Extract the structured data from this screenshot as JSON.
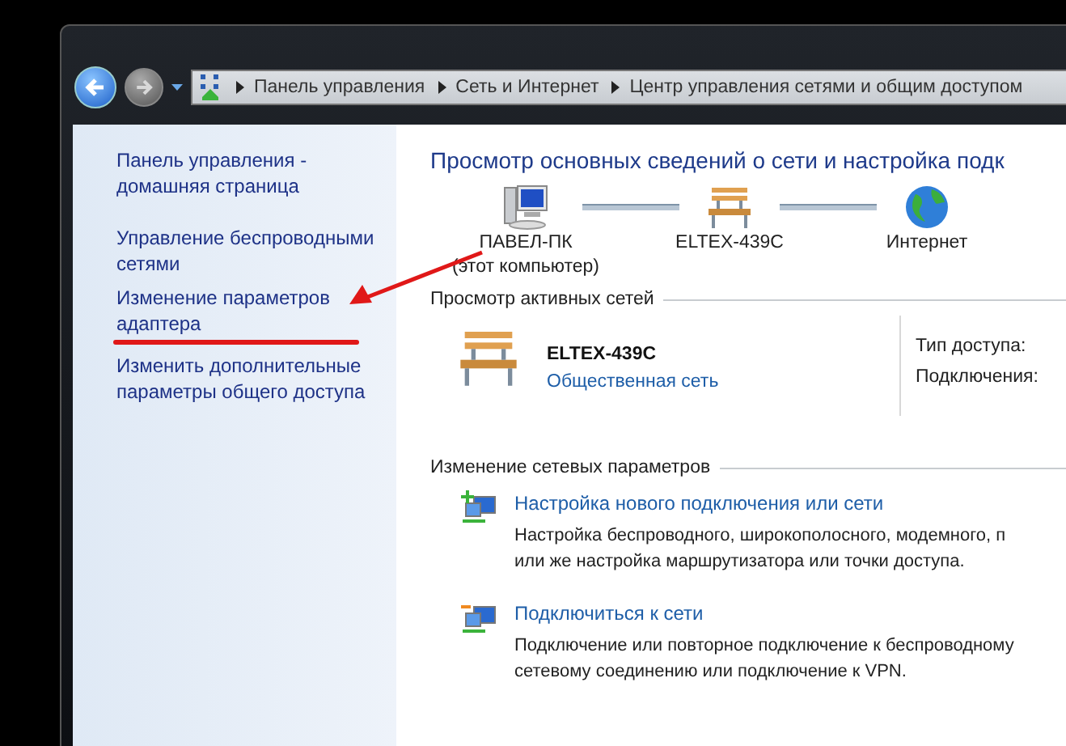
{
  "breadcrumb": [
    "Панель управления",
    "Сеть и Интернет",
    "Центр управления сетями и общим доступом"
  ],
  "sidebar": {
    "links": [
      {
        "lines": [
          "Панель управления -",
          "домашняя страница"
        ]
      },
      {
        "lines": [
          "Управление беспроводными",
          "сетями"
        ]
      },
      {
        "lines": [
          "Изменение параметров",
          "адаптера"
        ]
      },
      {
        "lines": [
          "Изменить дополнительные",
          "параметры общего доступа"
        ]
      }
    ]
  },
  "main": {
    "title": "Просмотр основных сведений о сети и настройка подк",
    "network_map": [
      {
        "kind": "computer",
        "name": "ПАВЕЛ-ПК",
        "sublabel": "(этот компьютер)"
      },
      {
        "kind": "bench",
        "name": "ELTEX-439C"
      },
      {
        "kind": "globe",
        "name": "Интернет"
      }
    ],
    "active_networks": {
      "heading": "Просмотр активных сетей",
      "network": {
        "name": "ELTEX-439C",
        "type": "Общественная сеть"
      },
      "properties": [
        "Тип доступа:",
        "Подключения:"
      ]
    },
    "change_settings": {
      "heading": "Изменение сетевых параметров",
      "tasks": [
        {
          "kind": "new",
          "title": "Настройка нового подключения или сети",
          "description": [
            "Настройка беспроводного, широкополосного, модемного, п",
            "или же настройка маршрутизатора или точки доступа."
          ]
        },
        {
          "kind": "connect",
          "title": "Подключиться к сети",
          "description": [
            "Подключение или повторное подключение к беспроводному",
            "сетевому соединению или подключение к VPN."
          ]
        }
      ]
    }
  }
}
